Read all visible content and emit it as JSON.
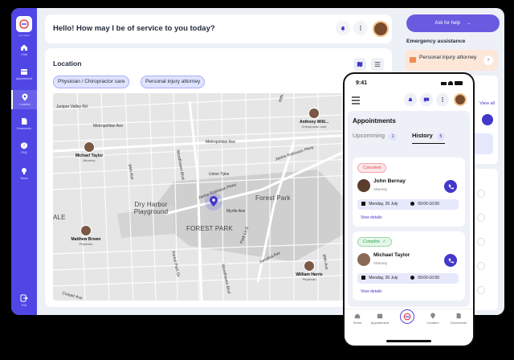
{
  "app": {
    "logo_caption": "Your Medic"
  },
  "sidebar": {
    "items": [
      {
        "label": "Chat",
        "icon": "home-icon"
      },
      {
        "label": "Appointment",
        "icon": "calendar-icon"
      },
      {
        "label": "Location",
        "icon": "location-pin-icon",
        "active": true
      },
      {
        "label": "Documents",
        "icon": "document-icon"
      },
      {
        "label": "FAQ",
        "icon": "faq-icon"
      },
      {
        "label": "News",
        "icon": "bulb-icon"
      }
    ],
    "exit_label": "Exit"
  },
  "header": {
    "greeting": "Hello! How may I be of service to you today?"
  },
  "location": {
    "title": "Location",
    "filters": [
      "Physician / Chiropractor care",
      "Personal injury attorney"
    ],
    "map_labels": {
      "streets": [
        "Juniper Valley Rd",
        "Metropolitan Ave",
        "Metropolitan Ave",
        "Woodhaven Blvd",
        "Union Tpke",
        "Jackie Robinson Pkwy",
        "Jackie Robinson Pkwy",
        "Myrtle Ave",
        "Park Ln S",
        "Jamaica Ave",
        "Woodhaven Blvd",
        "Forest Park Dr",
        "84th Ave",
        "89th Ave",
        "69th St",
        "Cooper Ave"
      ],
      "places": [
        "Dry Harbor Playground",
        "Forest Park",
        "FOREST PARK",
        "ALE"
      ]
    },
    "markers": [
      {
        "name": "Anthony Willi...",
        "role": "Chiropractor care"
      },
      {
        "name": "Michael Taylor",
        "role": "Attorney"
      },
      {
        "name": "Matthew Brown",
        "role": "Physician"
      },
      {
        "name": "William Harris",
        "role": "Physician"
      }
    ]
  },
  "right_panel": {
    "ask_button": "Ask for help",
    "emergency_title": "Emergency assistance",
    "emergency_items": [
      "Personal injury attorney"
    ],
    "view_all": "View all"
  },
  "phone": {
    "time": "9:41",
    "title": "Appointments",
    "tabs": [
      {
        "label": "Upcomming",
        "count": "1"
      },
      {
        "label": "History",
        "count": "5"
      }
    ],
    "cards": [
      {
        "status": "Canceled",
        "name": "John Bernay",
        "role": "Attorney",
        "date": "Monday, 26 July",
        "time": "09:00-10:00",
        "link": "View details"
      },
      {
        "status": "Complite",
        "name": "Michael Taylor",
        "role": "Attorney",
        "date": "Monday, 26 July",
        "time": "09:00-10:00",
        "link": "View details"
      }
    ],
    "tabbar": [
      "Home",
      "Appointment",
      "",
      "Location",
      "Documents"
    ]
  },
  "colors": {
    "accent": "#4f46e5",
    "canceled": "#e5484d",
    "complete": "#2fa84f"
  }
}
